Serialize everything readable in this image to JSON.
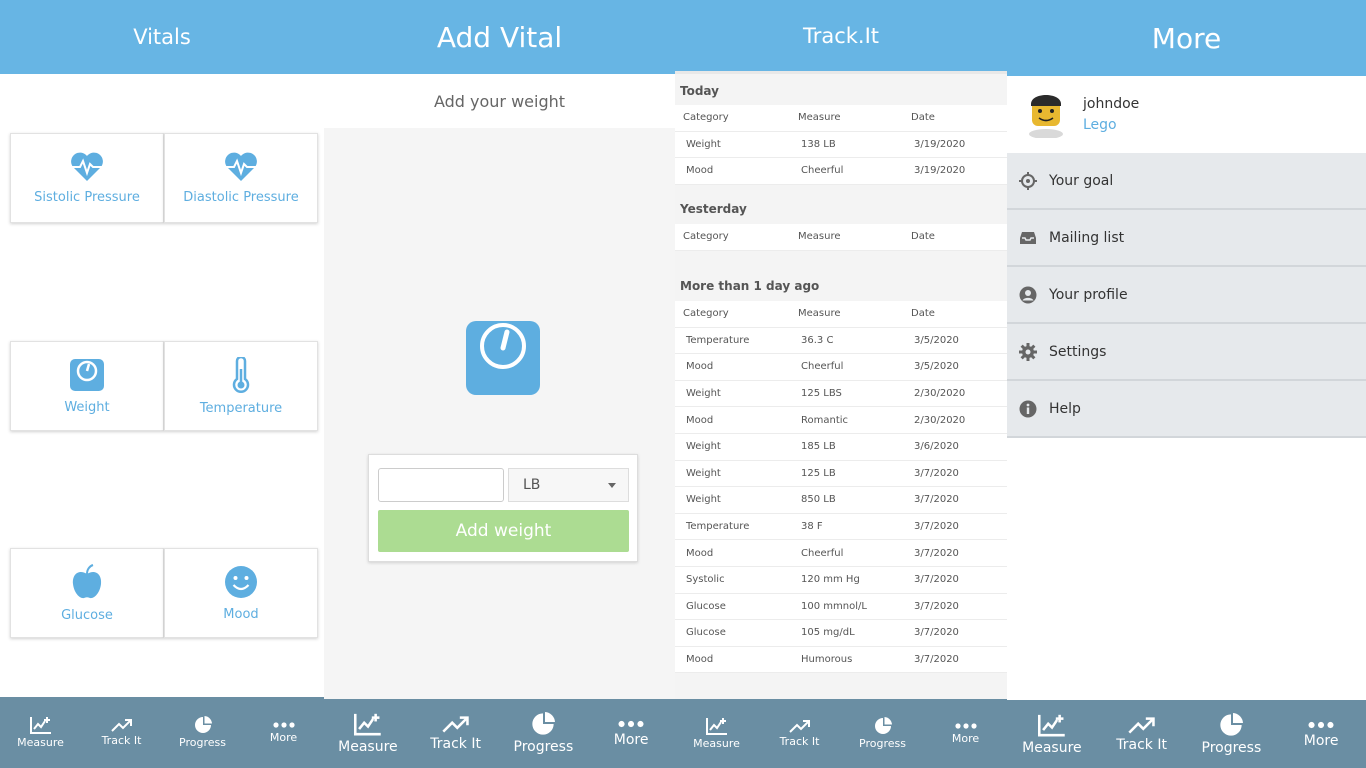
{
  "panels": {
    "vitals": {
      "title": "Vitals",
      "tiles": [
        {
          "label": "Sistolic Pressure",
          "icon": "heart-pulse-icon"
        },
        {
          "label": "Diastolic Pressure",
          "icon": "heart-pulse-icon"
        },
        {
          "label": "Weight",
          "icon": "scale-icon"
        },
        {
          "label": "Temperature",
          "icon": "thermometer-icon"
        },
        {
          "label": "Glucose",
          "icon": "apple-icon"
        },
        {
          "label": "Mood",
          "icon": "smiley-icon"
        }
      ]
    },
    "add_vital": {
      "title": "Add Vital",
      "subtitle": "Add your weight",
      "weight_value": "",
      "unit": "LB",
      "button_label": "Add weight"
    },
    "track_it": {
      "title": "Track.It",
      "columns": [
        "Category",
        "Measure",
        "Date"
      ],
      "sections": [
        {
          "title": "Today",
          "rows": [
            [
              "Weight",
              "138 LB",
              "3/19/2020"
            ],
            [
              "Mood",
              "Cheerful",
              "3/19/2020"
            ]
          ]
        },
        {
          "title": "Yesterday",
          "rows": []
        },
        {
          "title": "More than 1 day ago",
          "rows": [
            [
              "Temperature",
              "36.3 C",
              "3/5/2020"
            ],
            [
              "Mood",
              "Cheerful",
              "3/5/2020"
            ],
            [
              "Weight",
              "125 LBS",
              "2/30/2020"
            ],
            [
              "Mood",
              "Romantic",
              "2/30/2020"
            ],
            [
              "Weight",
              "185 LB",
              "3/6/2020"
            ],
            [
              "Weight",
              "125 LB",
              "3/7/2020"
            ],
            [
              "Weight",
              "850 LB",
              "3/7/2020"
            ],
            [
              "Temperature",
              "38 F",
              "3/7/2020"
            ],
            [
              "Mood",
              "Cheerful",
              "3/7/2020"
            ],
            [
              "Systolic",
              "120 mm Hg",
              "3/7/2020"
            ],
            [
              "Glucose",
              "100 mmnol/L",
              "3/7/2020"
            ],
            [
              "Glucose",
              "105 mg/dL",
              "3/7/2020"
            ],
            [
              "Mood",
              "Humorous",
              "3/7/2020"
            ]
          ]
        }
      ]
    },
    "more": {
      "title": "More",
      "username": "johndoe",
      "user_sub": "Lego",
      "menu": [
        {
          "label": "Your goal",
          "icon": "crosshair-icon"
        },
        {
          "label": "Mailing list",
          "icon": "inbox-icon"
        },
        {
          "label": "Your profile",
          "icon": "user-circle-icon"
        },
        {
          "label": "Settings",
          "icon": "gear-icon"
        },
        {
          "label": "Help",
          "icon": "info-icon"
        }
      ]
    }
  },
  "tabbar": [
    {
      "label": "Measure",
      "icon": "measure-chart-icon"
    },
    {
      "label": "Track It",
      "icon": "trend-up-icon"
    },
    {
      "label": "Progress",
      "icon": "pie-chart-icon"
    },
    {
      "label": "More",
      "icon": "more-dots-icon"
    }
  ],
  "colors": {
    "header": "#67b5e4",
    "tabbar": "#6a8ea3",
    "accent": "#5eaee0",
    "button": "#acdc92"
  }
}
